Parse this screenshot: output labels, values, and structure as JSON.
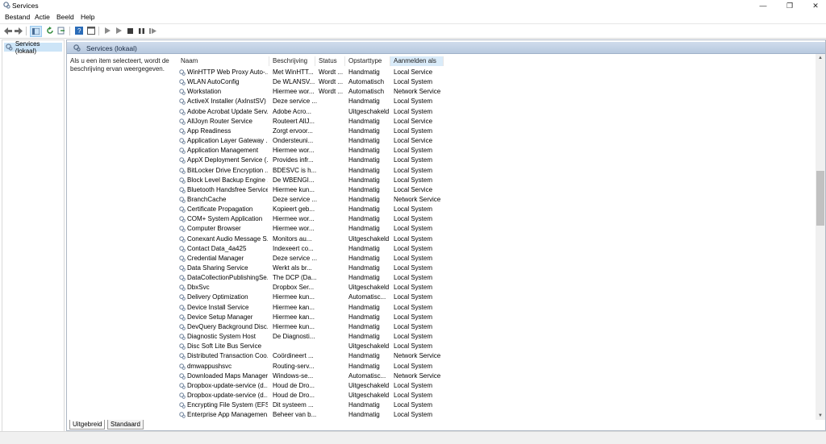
{
  "window": {
    "title": "Services",
    "minimize": "—",
    "maximize": "❐",
    "close": "✕"
  },
  "menu": [
    "Bestand",
    "Actie",
    "Beeld",
    "Help"
  ],
  "tree": {
    "item": "Services (lokaal)"
  },
  "pane": {
    "title": "Services (lokaal)",
    "description": "Als u een item selecteert, wordt de beschrijving ervan weergegeven."
  },
  "columns": {
    "name": "Naam",
    "description": "Beschrijving",
    "status": "Status",
    "startup": "Opstarttype",
    "logon": "Aanmelden als"
  },
  "services": [
    [
      "WinHTTP Web Proxy Auto-...",
      "Met WinHTT...",
      "Wordt ...",
      "Handmatig",
      "Local Service"
    ],
    [
      "WLAN AutoConfig",
      "De WLANSV...",
      "Wordt ...",
      "Automatisch",
      "Local System"
    ],
    [
      "Workstation",
      "Hiermee wor...",
      "Wordt ...",
      "Automatisch",
      "Network Service"
    ],
    [
      "ActiveX Installer (AxInstSV)",
      "Deze service ...",
      "",
      "Handmatig",
      "Local System"
    ],
    [
      "Adobe Acrobat Update Serv...",
      "Adobe Acro...",
      "",
      "Uitgeschakeld",
      "Local System"
    ],
    [
      "AllJoyn Router Service",
      "Routeert AllJ...",
      "",
      "Handmatig",
      "Local Service"
    ],
    [
      "App Readiness",
      "Zorgt ervoor...",
      "",
      "Handmatig",
      "Local System"
    ],
    [
      "Application Layer Gateway ...",
      "Ondersteuni...",
      "",
      "Handmatig",
      "Local Service"
    ],
    [
      "Application Management",
      "Hiermee wor...",
      "",
      "Handmatig",
      "Local System"
    ],
    [
      "AppX Deployment Service (...",
      "Provides infr...",
      "",
      "Handmatig",
      "Local System"
    ],
    [
      "BitLocker Drive Encryption ...",
      "BDESVC is h...",
      "",
      "Handmatig",
      "Local System"
    ],
    [
      "Block Level Backup Engine ...",
      "De WBENGI...",
      "",
      "Handmatig",
      "Local System"
    ],
    [
      "Bluetooth Handsfree Service",
      "Hiermee kun...",
      "",
      "Handmatig",
      "Local Service"
    ],
    [
      "BranchCache",
      "Deze service ...",
      "",
      "Handmatig",
      "Network Service"
    ],
    [
      "Certificate Propagation",
      "Kopieert geb...",
      "",
      "Handmatig",
      "Local System"
    ],
    [
      "COM+ System Application",
      "Hiermee wor...",
      "",
      "Handmatig",
      "Local System"
    ],
    [
      "Computer Browser",
      "Hiermee wor...",
      "",
      "Handmatig",
      "Local System"
    ],
    [
      "Conexant Audio Message S...",
      "Monitors au...",
      "",
      "Uitgeschakeld",
      "Local System"
    ],
    [
      "Contact Data_4a425",
      "Indexeert co...",
      "",
      "Handmatig",
      "Local System"
    ],
    [
      "Credential Manager",
      "Deze service ...",
      "",
      "Handmatig",
      "Local System"
    ],
    [
      "Data Sharing Service",
      "Werkt als br...",
      "",
      "Handmatig",
      "Local System"
    ],
    [
      "DataCollectionPublishingSe...",
      "The DCP (Da...",
      "",
      "Handmatig",
      "Local System"
    ],
    [
      "DbxSvc",
      "Dropbox Ser...",
      "",
      "Uitgeschakeld",
      "Local System"
    ],
    [
      "Delivery Optimization",
      "Hiermee kun...",
      "",
      "Automatisc...",
      "Local System"
    ],
    [
      "Device Install Service",
      "Hiermee kan...",
      "",
      "Handmatig",
      "Local System"
    ],
    [
      "Device Setup Manager",
      "Hiermee kan...",
      "",
      "Handmatig",
      "Local System"
    ],
    [
      "DevQuery Background Disc...",
      "Hiermee kun...",
      "",
      "Handmatig",
      "Local System"
    ],
    [
      "Diagnostic System Host",
      "De Diagnosti...",
      "",
      "Handmatig",
      "Local System"
    ],
    [
      "Disc Soft Lite Bus Service",
      "",
      "",
      "Uitgeschakeld",
      "Local System"
    ],
    [
      "Distributed Transaction Coo...",
      "Coördineert ...",
      "",
      "Handmatig",
      "Network Service"
    ],
    [
      "dmwappushsvc",
      "Routing-serv...",
      "",
      "Handmatig",
      "Local System"
    ],
    [
      "Downloaded Maps Manager",
      "Windows-se...",
      "",
      "Automatisc...",
      "Network Service"
    ],
    [
      "Dropbox-update-service (d...",
      "Houd de Dro...",
      "",
      "Uitgeschakeld",
      "Local System"
    ],
    [
      "Dropbox-update-service (d...",
      "Houd de Dro...",
      "",
      "Uitgeschakeld",
      "Local System"
    ],
    [
      "Encrypting File System (EFS)",
      "Dit systeem ...",
      "",
      "Handmatig",
      "Local System"
    ],
    [
      "Enterprise App Managemen...",
      "Beheer van b...",
      "",
      "Handmatig",
      "Local System"
    ]
  ],
  "tabs": {
    "extended": "Uitgebreid",
    "standard": "Standaard"
  },
  "colors": {
    "header_gradient_top": "#cfdcec",
    "selection": "#cce4f7",
    "sort_col": "#d9ebf9"
  },
  "icons": {
    "service": "gear-icon"
  }
}
